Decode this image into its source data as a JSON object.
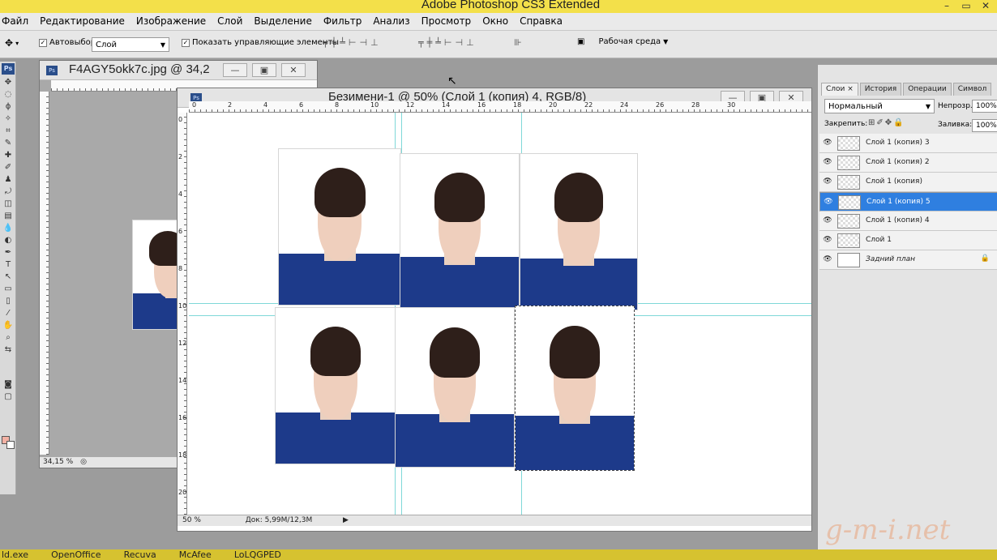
{
  "app": {
    "title": "Adobe Photoshop CS3 Extended"
  },
  "menu": [
    "Файл",
    "Редактирование",
    "Изображение",
    "Слой",
    "Выделение",
    "Фильтр",
    "Анализ",
    "Просмотр",
    "Окно",
    "Справка"
  ],
  "options": {
    "autoselect_label": "Автовыбор:",
    "autoselect_value": "Слой",
    "show_controls_label": "Показать управляющие элементы",
    "workspace_label": "Рабочая среда"
  },
  "toolbox": {
    "logo": "Ps"
  },
  "doc_back": {
    "title": "F4AGY5okk7c.jpg @ 34,2",
    "zoom": "34,15 %"
  },
  "doc_front": {
    "title": "Безимени-1 @ 50% (Слой 1 (копия) 4, RGB/8)",
    "zoom": "50 %",
    "doc_info": "Док: 5,99M/12,3M",
    "ruler_h": [
      "0",
      "2",
      "4",
      "6",
      "8",
      "10",
      "12",
      "14",
      "16",
      "18",
      "20",
      "22",
      "24",
      "26",
      "28",
      "30"
    ],
    "ruler_v": [
      "0",
      "2",
      "4",
      "6",
      "8",
      "10",
      "12",
      "14",
      "16",
      "18",
      "20"
    ]
  },
  "panel": {
    "tabs": [
      "Слои ×",
      "История",
      "Операции",
      "Символ"
    ],
    "blend_mode": "Нормальный",
    "opacity_label": "Непрозр.:",
    "opacity": "100%",
    "lock_label": "Закрепить:",
    "fill_label": "Заливка:",
    "fill": "100%",
    "layers": [
      {
        "name": "Слой 1 (копия) 3",
        "selected": false,
        "background": false
      },
      {
        "name": "Слой 1 (копия) 2",
        "selected": false,
        "background": false
      },
      {
        "name": "Слой 1 (копия)",
        "selected": false,
        "background": false
      },
      {
        "name": "Слой 1 (копия) 5",
        "selected": true,
        "background": false
      },
      {
        "name": "Слой 1 (копия) 4",
        "selected": false,
        "background": false
      },
      {
        "name": "Слой 1",
        "selected": false,
        "background": false
      },
      {
        "name": "Задний план",
        "selected": false,
        "background": true
      }
    ]
  },
  "taskbar": [
    "ld.exe",
    "OpenOffice",
    "Recuva",
    "McAfee",
    "LoLQGPED"
  ],
  "watermark": "g-m-i.net",
  "colors": {
    "titlebar": "#f3e04a",
    "selection": "#2f7fe0",
    "shirt": "#1d3a8a",
    "guide": "#7fd8d8"
  }
}
